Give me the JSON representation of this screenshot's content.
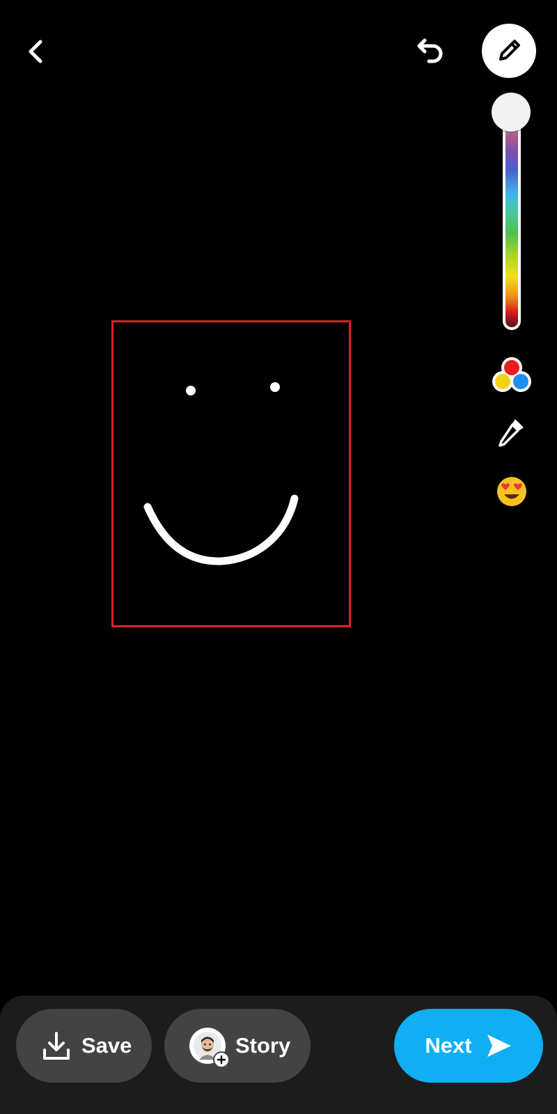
{
  "top_bar": {
    "back_icon": "chevron-left-icon",
    "undo_icon": "undo-icon",
    "pen_icon": "pencil-icon"
  },
  "tools": {
    "color_slider_level": 0.0,
    "palette_icon": "color-palette-icon",
    "eyedropper_icon": "eyedropper-icon",
    "emoji_icon": "heart-eyes-emoji-icon"
  },
  "canvas": {
    "stroke_color": "#ffffff",
    "highlight_color": "#e0202a"
  },
  "bottom_bar": {
    "save_label": "Save",
    "story_label": "Story",
    "next_label": "Next",
    "accent_color": "#10aef2"
  }
}
